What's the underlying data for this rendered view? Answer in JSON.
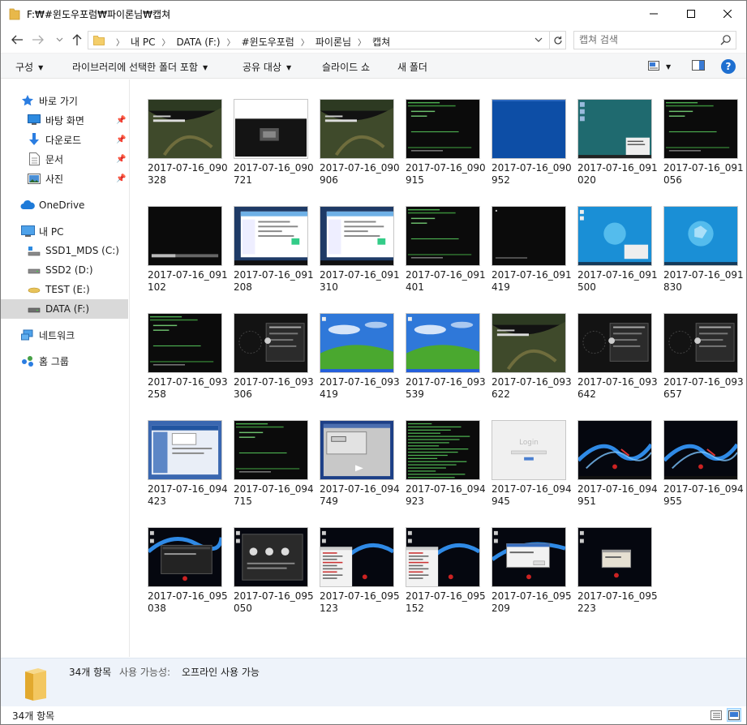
{
  "window": {
    "title": "F:₩#윈도우포럼₩파이론님₩캡쳐"
  },
  "address": {
    "crumbs": [
      "내 PC",
      "DATA (F:)",
      "#윈도우포럼",
      "파이론님",
      "캡쳐"
    ]
  },
  "search": {
    "placeholder": "캡쳐 검색"
  },
  "commands": {
    "organize": "구성",
    "include_library": "라이브러리에 선택한 폴더 포함",
    "share": "공유 대상",
    "slideshow": "슬라이드 쇼",
    "new_folder": "새 폴더",
    "help": "?"
  },
  "nav": {
    "quick_access": "바로 가기",
    "desktop": "바탕 화면",
    "downloads": "다운로드",
    "documents": "문서",
    "pictures": "사진",
    "onedrive": "OneDrive",
    "this_pc": "내 PC",
    "drive_c": "SSD1_MDS (C:)",
    "drive_d": "SSD2 (D:)",
    "drive_e": "TEST (E:)",
    "drive_f": "DATA (F:)",
    "network": "네트워크",
    "homegroup": "홈 그룹"
  },
  "files": [
    {
      "name": "2017-07-16_090328",
      "kind": "xp-boot"
    },
    {
      "name": "2017-07-16_090721",
      "kind": "small-boot"
    },
    {
      "name": "2017-07-16_090906",
      "kind": "xp-boot"
    },
    {
      "name": "2017-07-16_090915",
      "kind": "console"
    },
    {
      "name": "2017-07-16_090952",
      "kind": "blue"
    },
    {
      "name": "2017-07-16_091020",
      "kind": "teal-desktop"
    },
    {
      "name": "2017-07-16_091056",
      "kind": "console"
    },
    {
      "name": "2017-07-16_091102",
      "kind": "black-bar"
    },
    {
      "name": "2017-07-16_091208",
      "kind": "explorer"
    },
    {
      "name": "2017-07-16_091310",
      "kind": "explorer"
    },
    {
      "name": "2017-07-16_091401",
      "kind": "console"
    },
    {
      "name": "2017-07-16_091419",
      "kind": "black"
    },
    {
      "name": "2017-07-16_091500",
      "kind": "win7"
    },
    {
      "name": "2017-07-16_091830",
      "kind": "win7-plain"
    },
    {
      "name": "2017-07-16_093258",
      "kind": "console"
    },
    {
      "name": "2017-07-16_093306",
      "kind": "dark-dialog"
    },
    {
      "name": "2017-07-16_093419",
      "kind": "bliss"
    },
    {
      "name": "2017-07-16_093539",
      "kind": "bliss"
    },
    {
      "name": "2017-07-16_093622",
      "kind": "xp-boot"
    },
    {
      "name": "2017-07-16_093642",
      "kind": "dark-dialog"
    },
    {
      "name": "2017-07-16_093657",
      "kind": "dark-dialog"
    },
    {
      "name": "2017-07-16_094423",
      "kind": "blue-setup"
    },
    {
      "name": "2017-07-16_094715",
      "kind": "console"
    },
    {
      "name": "2017-07-16_094749",
      "kind": "gray-setup"
    },
    {
      "name": "2017-07-16_094923",
      "kind": "console-dense"
    },
    {
      "name": "2017-07-16_094945",
      "kind": "login"
    },
    {
      "name": "2017-07-16_094951",
      "kind": "dragon"
    },
    {
      "name": "2017-07-16_094955",
      "kind": "dragon"
    },
    {
      "name": "2017-07-16_095038",
      "kind": "dragon-dialog"
    },
    {
      "name": "2017-07-16_095050",
      "kind": "dragon-dark-dialog"
    },
    {
      "name": "2017-07-16_095123",
      "kind": "dragon-window"
    },
    {
      "name": "2017-07-16_095152",
      "kind": "dragon-window"
    },
    {
      "name": "2017-07-16_095209",
      "kind": "dragon-msg"
    },
    {
      "name": "2017-07-16_095223",
      "kind": "dragon-msg-small"
    }
  ],
  "details": {
    "count": "34개 항목",
    "availability_label": "사용 가능성:",
    "availability_value": "오프라인 사용 가능"
  },
  "status": {
    "count": "34개 항목"
  },
  "colors": {
    "accent": "#0078d7",
    "folder": "#e8b84a",
    "selected": "#d9d9d9",
    "details_bg": "#eef3fa"
  }
}
